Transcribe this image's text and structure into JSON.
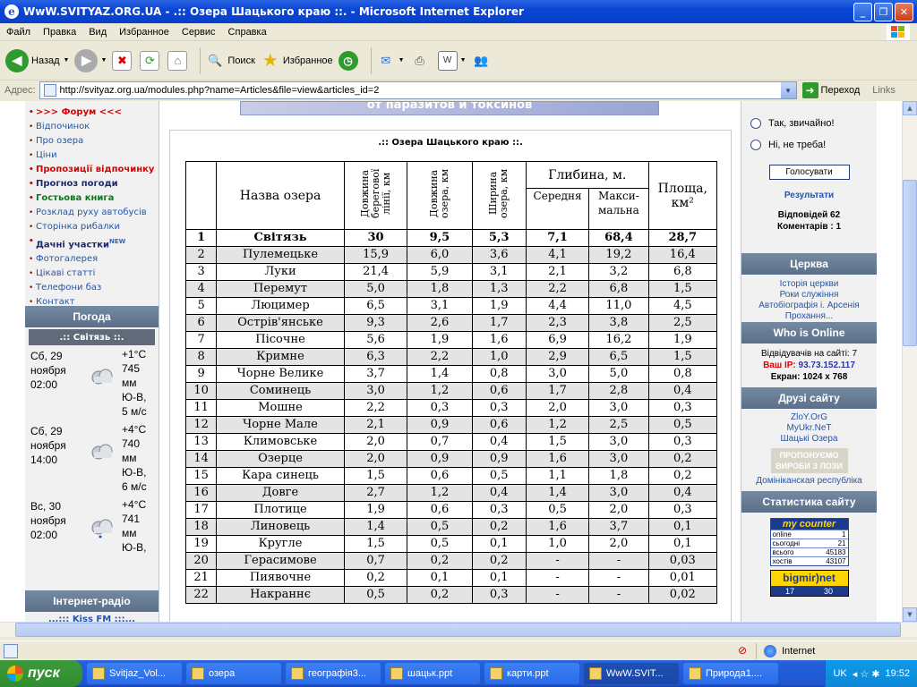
{
  "window": {
    "title": "WwW.SVITYAZ.ORG.UA - .:: Озера Шацького краю ::. - Microsoft Internet Explorer"
  },
  "menu": [
    "Файл",
    "Правка",
    "Вид",
    "Избранное",
    "Сервис",
    "Справка"
  ],
  "toolbar": {
    "back": "Назад",
    "search": "Поиск",
    "favorites": "Избранное"
  },
  "address": {
    "label": "Адрес:",
    "url": "http://svityaz.org.ua/modules.php?name=Articles&file=view&articles_id=2",
    "go": "Переход",
    "links": "Links"
  },
  "left": {
    "nav": [
      {
        "label": ">>> Форум <<<",
        "style": "red"
      },
      {
        "label": "Відпочинок",
        "style": ""
      },
      {
        "label": "Про озера",
        "style": ""
      },
      {
        "label": "Ціни",
        "style": ""
      },
      {
        "label": "Пропозиції відпочинку",
        "style": "red"
      },
      {
        "label": "Прогноз погоди",
        "style": "navy"
      },
      {
        "label": "Гостьова книга",
        "style": "green"
      },
      {
        "label": "Розклад руху автобусів",
        "style": ""
      },
      {
        "label": "Сторінка рибалки",
        "style": ""
      },
      {
        "label": "Дачні участки",
        "style": "navy",
        "sup": "NEW"
      },
      {
        "label": "Фотогалерея",
        "style": ""
      },
      {
        "label": "Цікаві статті",
        "style": ""
      },
      {
        "label": "Телефони баз",
        "style": ""
      },
      {
        "label": "Контакт",
        "style": ""
      }
    ],
    "weather_title": "Погода",
    "weather_place": ".:: Світязь ::.",
    "forecast": [
      {
        "day": "Сб, 29",
        "month": "ноября",
        "time": "02:00",
        "temp": "+1°C",
        "pressure": "745",
        "unit": "мм",
        "wind": "Ю-В,",
        "speed": "5 м/с"
      },
      {
        "day": "Сб, 29",
        "month": "ноября",
        "time": "14:00",
        "temp": "+4°C",
        "pressure": "740",
        "unit": "мм",
        "wind": "Ю-В,",
        "speed": "6 м/с"
      },
      {
        "day": "Вс, 30",
        "month": "ноября",
        "time": "02:00",
        "temp": "+4°C",
        "pressure": "741",
        "unit": "мм",
        "wind": "Ю-В,",
        "speed": ""
      }
    ],
    "radio_title": "Інтернет-радіо",
    "radio_station": "...::: Kiss FM :::..."
  },
  "banner": {
    "text": "от паразитов и токсинов"
  },
  "article": {
    "title": ".:: Озера Шацького краю ::.",
    "headers": {
      "name": "Назва озера",
      "shore": "Довжина берегової лінії, км",
      "length": "Довжина озера, км",
      "width": "Ширина озера, км",
      "depth": "Глибина, м.",
      "avg": "Середня",
      "max": "Макси-мальна",
      "area": "Площа, км²"
    },
    "rows": [
      [
        "1",
        "Світязь",
        "30",
        "9,5",
        "5,3",
        "7,1",
        "68,4",
        "28,7"
      ],
      [
        "2",
        "Пулемецьке",
        "15,9",
        "6,0",
        "3,6",
        "4,1",
        "19,2",
        "16,4"
      ],
      [
        "3",
        "Луки",
        "21,4",
        "5,9",
        "3,1",
        "2,1",
        "3,2",
        "6,8"
      ],
      [
        "4",
        "Перемут",
        "5,0",
        "1,8",
        "1,3",
        "2,2",
        "6,8",
        "1,5"
      ],
      [
        "5",
        "Люцимер",
        "6,5",
        "3,1",
        "1,9",
        "4,4",
        "11,0",
        "4,5"
      ],
      [
        "6",
        "Острів'янське",
        "9,3",
        "2,6",
        "1,7",
        "2,3",
        "3,8",
        "2,5"
      ],
      [
        "7",
        "Пісочне",
        "5,6",
        "1,9",
        "1,6",
        "6,9",
        "16,2",
        "1,9"
      ],
      [
        "8",
        "Кримне",
        "6,3",
        "2,2",
        "1,0",
        "2,9",
        "6,5",
        "1,5"
      ],
      [
        "9",
        "Чорне Велике",
        "3,7",
        "1,4",
        "0,8",
        "3,0",
        "5,0",
        "0,8"
      ],
      [
        "10",
        "Соминець",
        "3,0",
        "1,2",
        "0,6",
        "1,7",
        "2,8",
        "0,4"
      ],
      [
        "11",
        "Мошне",
        "2,2",
        "0,3",
        "0,3",
        "2,0",
        "3,0",
        "0,3"
      ],
      [
        "12",
        "Чорне Мале",
        "2,1",
        "0,9",
        "0,6",
        "1,2",
        "2,5",
        "0,5"
      ],
      [
        "13",
        "Климовське",
        "2,0",
        "0,7",
        "0,4",
        "1,5",
        "3,0",
        "0,3"
      ],
      [
        "14",
        "Озерце",
        "2,0",
        "0,9",
        "0,9",
        "1,6",
        "3,0",
        "0,2"
      ],
      [
        "15",
        "Кара синець",
        "1,5",
        "0,6",
        "0,5",
        "1,1",
        "1,8",
        "0,2"
      ],
      [
        "16",
        "Довге",
        "2,7",
        "1,2",
        "0,4",
        "1,4",
        "3,0",
        "0,4"
      ],
      [
        "17",
        "Плотице",
        "1,9",
        "0,6",
        "0,3",
        "0,5",
        "2,0",
        "0,3"
      ],
      [
        "18",
        "Линовець",
        "1,4",
        "0,5",
        "0,2",
        "1,6",
        "3,7",
        "0,1"
      ],
      [
        "19",
        "Кругле",
        "1,5",
        "0,5",
        "0,1",
        "1,0",
        "2,0",
        "0,1"
      ],
      [
        "20",
        "Герасимове",
        "0,7",
        "0,2",
        "0,2",
        "-",
        "-",
        "0,03"
      ],
      [
        "21",
        "Пиявочне",
        "0,2",
        "0,1",
        "0,1",
        "-",
        "-",
        "0,01"
      ],
      [
        "22",
        "Накраннє",
        "0,5",
        "0,2",
        "0,3",
        "-",
        "-",
        "0,02"
      ]
    ]
  },
  "right": {
    "poll_yes": "Так, звичайно!",
    "poll_no": "Ні, не треба!",
    "vote": "Голосувати",
    "results": "Результати",
    "answers": "Відповідей 62",
    "comments": "Коментарів : 1",
    "church_title": "Церква",
    "church_links": [
      "Історія церкви",
      "Роки служіння",
      "Автобіографія і. Арсенія",
      "Прохання..."
    ],
    "online_title": "Who is Online",
    "visitors": "Відвідувачів на сайті: 7",
    "ip_label": "Ваш IP:",
    "ip": "93.73.152.117",
    "screen": "Екран: 1024 x 768",
    "friends_title": "Друзі сайту",
    "friends": [
      "ZloY.OrG",
      "MyUkr.NeT",
      "Шацькі Озера"
    ],
    "offer": "ПРОПОНУЄМО ВИРОБИ З ЛОЗИ",
    "dominican": "Домініканская республіка",
    "stats_title": "Статистика сайту",
    "counter_title": "my counter",
    "counter": [
      [
        "online",
        "1"
      ],
      [
        "сьогодні",
        "21"
      ],
      [
        "всього",
        "45183"
      ],
      [
        "хостів",
        "43107"
      ]
    ],
    "bigmir": "bigmir)net",
    "bigmir_a": "17",
    "bigmir_b": "30"
  },
  "status": {
    "zone": "Internet"
  },
  "taskbar": {
    "start": "пуск",
    "tasks": [
      "Svitjaz_Vol...",
      "озера",
      "географія3...",
      "шацьк.ppt",
      "карти.ppt",
      "WwW.SVIT...",
      "Природа1...."
    ],
    "lang": "UK",
    "clock": "19:52"
  }
}
